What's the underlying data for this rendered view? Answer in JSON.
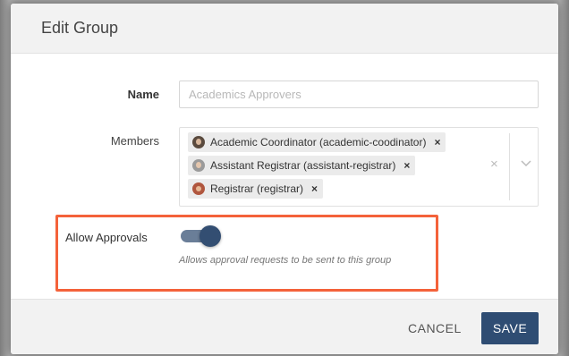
{
  "dialog": {
    "title": "Edit Group"
  },
  "form": {
    "name_label": "Name",
    "name_value": "",
    "name_placeholder": "Academics Approvers",
    "members_label": "Members",
    "members": [
      {
        "label": "Academic Coordinator (academic-coodinator)",
        "avatar": "user-avatar"
      },
      {
        "label": "Assistant Registrar (assistant-registrar)",
        "avatar": "user-avatar"
      },
      {
        "label": "Registrar (registrar)",
        "avatar": "user-avatar"
      }
    ],
    "clear_glyph": "×",
    "remove_glyph": "×",
    "allow_approvals_label": "Allow Approvals",
    "allow_approvals_enabled": true,
    "allow_approvals_help": "Allows approval requests to be sent to this group"
  },
  "footer": {
    "cancel_label": "CANCEL",
    "save_label": "SAVE"
  },
  "colors": {
    "primary": "#2f4d73",
    "toggle_track": "#6a7e98",
    "highlight": "#f4623a"
  }
}
